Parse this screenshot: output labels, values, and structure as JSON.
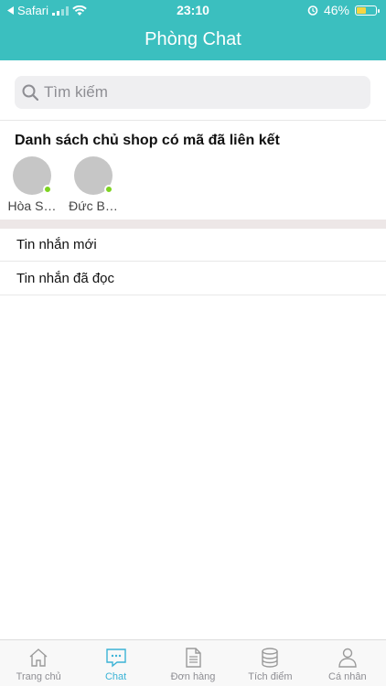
{
  "status_bar": {
    "back_app": "Safari",
    "time": "23:10",
    "battery": "46%"
  },
  "header": {
    "title": "Phòng Chat"
  },
  "search": {
    "placeholder": "Tìm kiếm"
  },
  "linked_shops": {
    "title": "Danh sách chủ shop có mã đã liên kết",
    "items": [
      {
        "name": "Hòa S…",
        "online": true
      },
      {
        "name": "Đức B…",
        "online": true
      }
    ]
  },
  "messages": {
    "new_label": "Tin nhắn mới",
    "read_label": "Tin nhắn đã đọc"
  },
  "tabbar": {
    "items": [
      {
        "label": "Trang chủ",
        "icon": "home-icon",
        "active": false
      },
      {
        "label": "Chat",
        "icon": "chat-icon",
        "active": true
      },
      {
        "label": "Đơn hàng",
        "icon": "document-icon",
        "active": false
      },
      {
        "label": "Tích điểm",
        "icon": "database-icon",
        "active": false
      },
      {
        "label": "Cá nhân",
        "icon": "user-icon",
        "active": false
      }
    ]
  },
  "colors": {
    "header": "#3bbfbf",
    "active_tab": "#3bb3d6",
    "online": "#7ed321"
  }
}
